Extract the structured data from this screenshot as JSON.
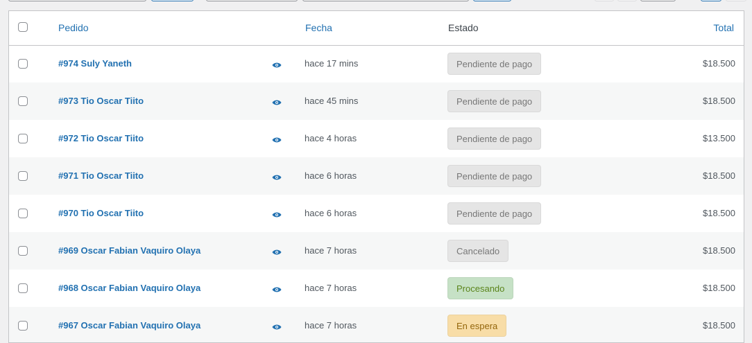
{
  "colors": {
    "link": "#2271b1",
    "pending_bg": "#e5e5e5",
    "pending_fg": "#777777",
    "cancelled_bg": "#e5e5e5",
    "cancelled_fg": "#777777",
    "processing_bg": "#c6e1c6",
    "processing_fg": "#5b841b",
    "onhold_bg": "#f8dda7",
    "onhold_fg": "#94660c"
  },
  "columns": {
    "pedido": "Pedido",
    "fecha": "Fecha",
    "estado": "Estado",
    "total": "Total"
  },
  "orders": [
    {
      "label": "#974 Suly Yaneth",
      "date": "hace 17 mins",
      "status": "Pendiente de pago",
      "status_type": "pending",
      "total": "$18.500",
      "preview_icon": "eye-icon"
    },
    {
      "label": "#973 Tio Oscar Tiito",
      "date": "hace 45 mins",
      "status": "Pendiente de pago",
      "status_type": "pending",
      "total": "$18.500",
      "preview_icon": "eye-icon"
    },
    {
      "label": "#972 Tio Oscar Tiito",
      "date": "hace 4 horas",
      "status": "Pendiente de pago",
      "status_type": "pending",
      "total": "$13.500",
      "preview_icon": "eye-icon"
    },
    {
      "label": "#971 Tio Oscar Tiito",
      "date": "hace 6 horas",
      "status": "Pendiente de pago",
      "status_type": "pending",
      "total": "$18.500",
      "preview_icon": "eye-icon"
    },
    {
      "label": "#970 Tio Oscar Tiito",
      "date": "hace 6 horas",
      "status": "Pendiente de pago",
      "status_type": "pending",
      "total": "$18.500",
      "preview_icon": "eye-icon"
    },
    {
      "label": "#969 Oscar Fabian Vaquiro Olaya",
      "date": "hace 7 horas",
      "status": "Cancelado",
      "status_type": "cancelled",
      "total": "$18.500",
      "preview_icon": "eye-icon"
    },
    {
      "label": "#968 Oscar Fabian Vaquiro Olaya",
      "date": "hace 7 horas",
      "status": "Procesando",
      "status_type": "processing",
      "total": "$18.500",
      "preview_icon": "eye-icon"
    },
    {
      "label": "#967 Oscar Fabian Vaquiro Olaya",
      "date": "hace 7 horas",
      "status": "En espera",
      "status_type": "onhold",
      "total": "$18.500",
      "preview_icon": "eye-icon"
    }
  ]
}
